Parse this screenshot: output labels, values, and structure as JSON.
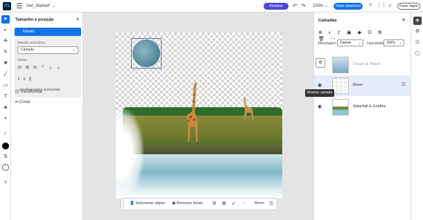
{
  "topbar": {
    "app_logo": "Ps",
    "doc_title": "Get_Started*",
    "doc_chevron": "⌄",
    "update_label": "Atualizar",
    "zoom": "100%",
    "zoom_chevron": "⌄",
    "download_label": "Fazer download",
    "login_label": "Fazer logon"
  },
  "tools": [
    "move-tool",
    "select-tool",
    "lasso-tool",
    "brush-tool",
    "eraser-tool",
    "pen-tool",
    "shape-tool",
    "text-tool",
    "sticker-tool",
    "crop-tool",
    "eyedropper-tool",
    "foreground-color",
    "swap-colors",
    "background-color",
    "collapse-tools"
  ],
  "left_panel": {
    "title": "Tamanho e posição",
    "mover_label": "Mover",
    "auto_select_label": "Seleção automática",
    "auto_select_value": "Camada",
    "align_label": "Alinhar",
    "advanced_label": "Configurações avançadas",
    "transform_label": "Transformar",
    "crop_label": "Cortar"
  },
  "bottom_toolbar": {
    "select_object": "Selecionar objeto",
    "remove_bg": "Remover fundo",
    "layer_name": "Moon"
  },
  "right_panel": {
    "title": "Camadas",
    "blend_label": "Mesclagem",
    "blend_value": "Clarear",
    "opacity_label": "Opacidade",
    "opacity_value": "100%",
    "tooltip": "Mostrar camada",
    "layers": [
      {
        "name": "Clouds & Planet",
        "visible": false,
        "selected": false
      },
      {
        "name": "Moon",
        "visible": true,
        "selected": true
      },
      {
        "name": "Waterfall & Giraffes",
        "visible": true,
        "selected": false
      }
    ]
  },
  "colors": {
    "accent": "#1473e6",
    "update_pill": "#4b48d6",
    "selection_bg": "#e6ecf9"
  }
}
